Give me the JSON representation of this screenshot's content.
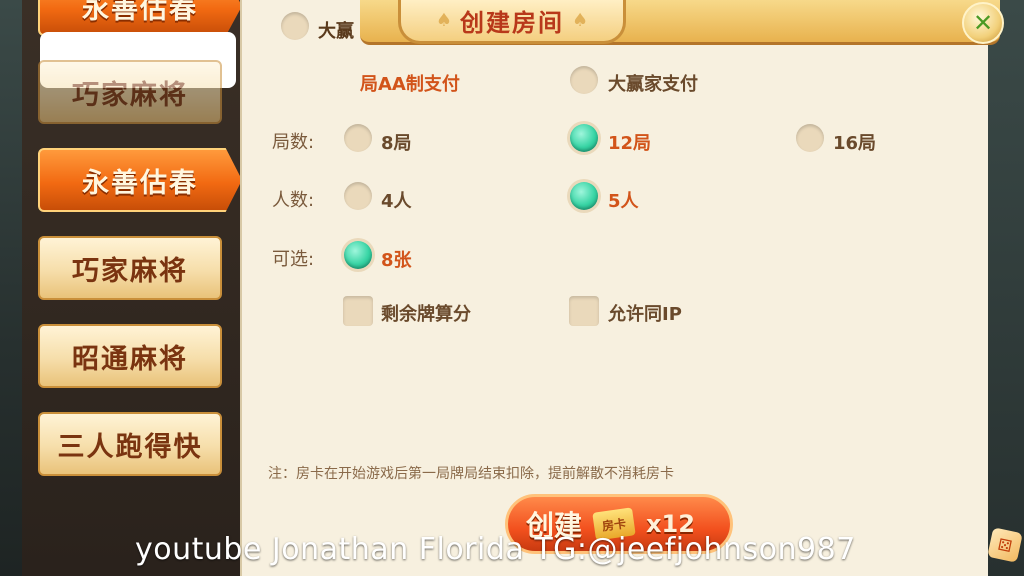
{
  "title": "创建房间",
  "sidebar": {
    "tabs": [
      {
        "label": "永善估春",
        "state": "partial-top"
      },
      {
        "label": "巧家麻将",
        "state": "partial"
      },
      {
        "label": "永善估春",
        "state": "active"
      },
      {
        "label": "巧家麻将",
        "state": "normal"
      },
      {
        "label": "昭通麻将",
        "state": "normal"
      },
      {
        "label": "三人跑得快",
        "state": "normal"
      }
    ]
  },
  "payment": {
    "option_top": "大赢",
    "option_aa": "局AA制支付",
    "option_winner": "大赢家支付"
  },
  "rounds": {
    "label": "局数:",
    "options": [
      "8局",
      "12局",
      "16局"
    ],
    "selected": "12局"
  },
  "players": {
    "label": "人数:",
    "options": [
      "4人",
      "5人"
    ],
    "selected": "5人"
  },
  "optional": {
    "label": "可选:",
    "option": "8张",
    "selected": "8张"
  },
  "checkboxes": {
    "leftover_score": "剩余牌算分",
    "allow_same_ip": "允许同IP"
  },
  "note": "注：房卡在开始游戏后第一局牌局结束扣除，提前解散不消耗房卡",
  "create": {
    "label": "创建",
    "card_label": "房卡",
    "count": "x12"
  },
  "watermark": "youtube Jonathan Florida   TG:@jeefjohnson987",
  "colors": {
    "accent": "#f26a12",
    "selected_radio": "#37d4a4",
    "selected_text": "#d2541a"
  }
}
